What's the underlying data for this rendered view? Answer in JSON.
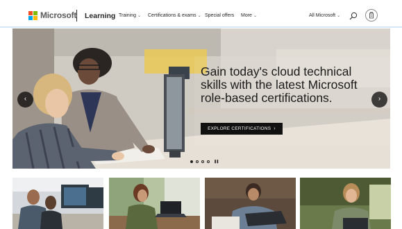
{
  "header": {
    "brand": "Microsoft",
    "product": "Learning",
    "nav": [
      {
        "label": "Training",
        "dropdown": true
      },
      {
        "label": "Certifications & exams",
        "dropdown": true
      },
      {
        "label": "Special offers",
        "dropdown": false
      },
      {
        "label": "More",
        "dropdown": true
      }
    ],
    "all_microsoft": "All Microsoft",
    "search_icon": "search-icon",
    "cart_icon": "cart-icon"
  },
  "hero": {
    "heading": "Gain today's cloud technical skills with the latest Microsoft role-based certifications.",
    "cta_label": "EXPLORE CERTIFICATIONS",
    "slides_total": 4,
    "active_slide": 1,
    "prev_icon": "chevron-left-icon",
    "next_icon": "chevron-right-icon",
    "pause_icon": "pause-icon"
  },
  "cards": [
    {
      "image": "two men at computer workstations"
    },
    {
      "image": "woman working on laptop by window"
    },
    {
      "image": "man typing on laptop"
    },
    {
      "image": "woman smiling at laptop"
    }
  ],
  "colors": {
    "accent": "#0067b8",
    "cta": "#111111",
    "logo_red": "#f25022",
    "logo_green": "#7fba00",
    "logo_blue": "#00a4ef",
    "logo_yellow": "#ffb900"
  }
}
